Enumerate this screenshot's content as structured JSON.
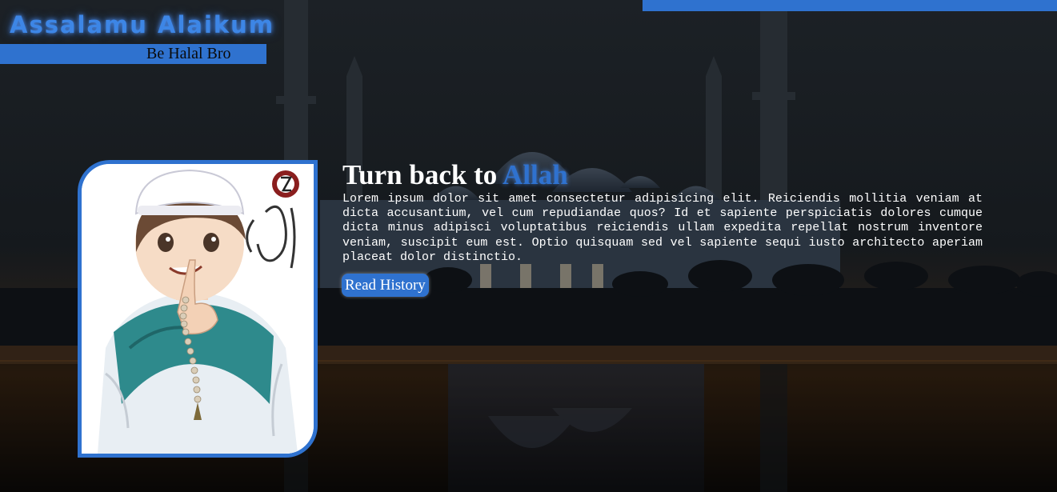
{
  "header": {
    "brand_title": "Assalamu Alaikum",
    "tagline": "Be Halal Bro"
  },
  "hero": {
    "headline_prefix": "Turn back to ",
    "headline_accent": "Allah",
    "body": "Lorem ipsum dolor sit amet consectetur adipisicing elit. Reiciendis mollitia veniam at dicta accusantium, vel cum repudiandae quos? Id et sapiente perspiciatis dolores cumque dicta minus adipisci voluptatibus reiciendis ullam expedita repellat nostrum inventore veniam, suscipit eum est. Optio quisquam sed vel sapiente sequi iusto architecto aperiam placeat dolor distinctio.",
    "button_label": "Read History"
  },
  "colors": {
    "accent": "#2f72cf",
    "text": "#ffffff",
    "background": "#14181c"
  }
}
